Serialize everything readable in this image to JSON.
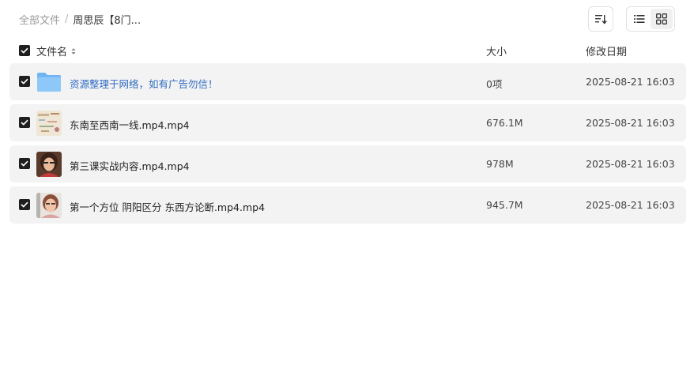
{
  "breadcrumb": {
    "root": "全部文件",
    "separator": "/",
    "current": "周思辰【8门..."
  },
  "toolbar": {
    "sort_icon": "sort-lines-icon",
    "list_view_icon": "list-view-icon",
    "grid_view_icon": "grid-view-icon"
  },
  "columns": {
    "name": "文件名",
    "size": "大小",
    "date": "修改日期"
  },
  "files": [
    {
      "name": "资源整理于网络，如有广告勿信！",
      "size": "0项",
      "date": "2025-08-21 16:03",
      "type": "folder"
    },
    {
      "name": "东南至西南一线.mp4.mp4",
      "size": "676.1M",
      "date": "2025-08-21 16:03",
      "type": "video"
    },
    {
      "name": "第三课实战内容.mp4.mp4",
      "size": "978M",
      "date": "2025-08-21 16:03",
      "type": "video"
    },
    {
      "name": "第一个方位 阴阳区分 东西方论断.mp4.mp4",
      "size": "945.7M",
      "date": "2025-08-21 16:03",
      "type": "video"
    }
  ],
  "colors": {
    "folder_link": "#2f6bc2",
    "row_bg": "#f3f3f3",
    "checkbox": "#1f1f1f"
  }
}
